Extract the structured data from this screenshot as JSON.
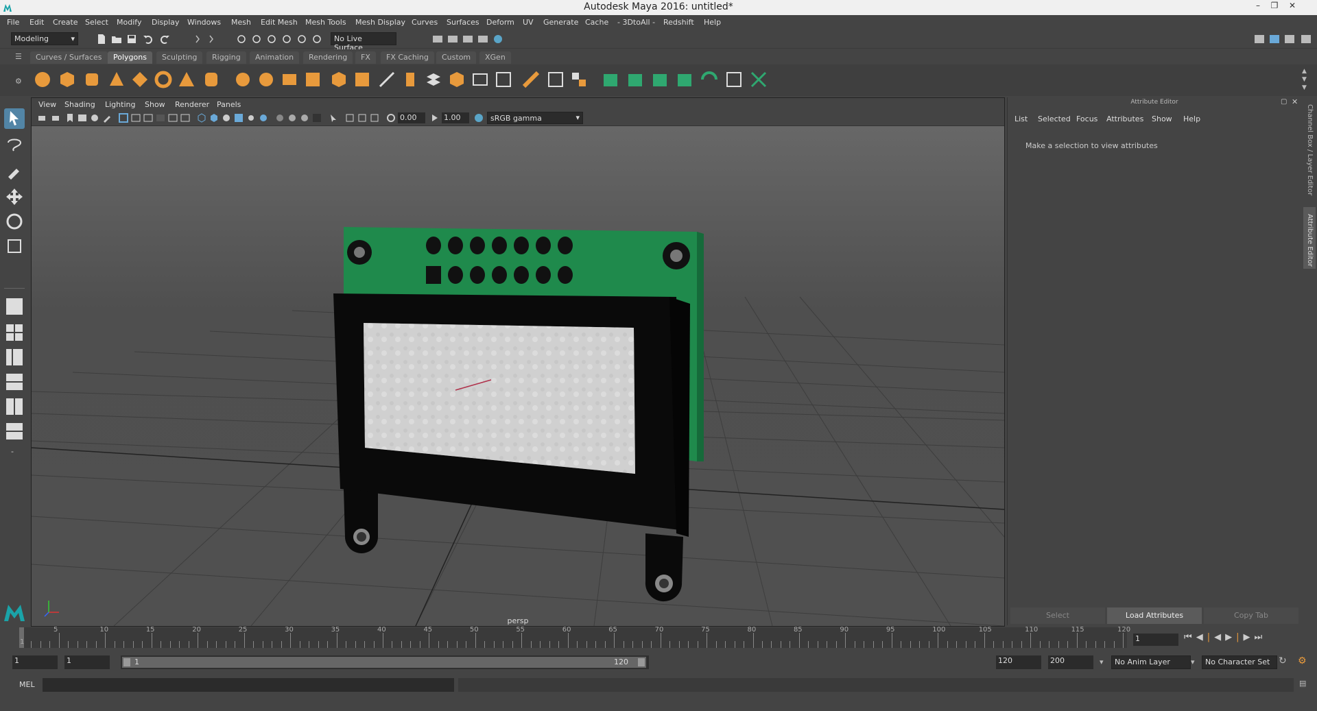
{
  "window": {
    "title": "Autodesk Maya 2016: untitled*"
  },
  "menubar": [
    "File",
    "Edit",
    "Create",
    "Select",
    "Modify",
    "Display",
    "Windows",
    "Mesh",
    "Edit Mesh",
    "Mesh Tools",
    "Mesh Display",
    "Curves",
    "Surfaces",
    "Deform",
    "UV",
    "Generate",
    "Cache",
    "- 3DtoAll -",
    "Redshift",
    "Help"
  ],
  "statusline": {
    "mode": "Modeling",
    "live_surface": "No Live Surface"
  },
  "shelf_tabs": [
    "Curves / Surfaces",
    "Polygons",
    "Sculpting",
    "Rigging",
    "Animation",
    "Rendering",
    "FX",
    "FX Caching",
    "Custom",
    "XGen"
  ],
  "shelf_active_tab": "Polygons",
  "viewport": {
    "menus": [
      "View",
      "Shading",
      "Lighting",
      "Show",
      "Renderer",
      "Panels"
    ],
    "exposure": "0.00",
    "gamma": "1.00",
    "color_space": "sRGB gamma",
    "camera_label": "persp"
  },
  "attribute_editor": {
    "title": "Attribute Editor",
    "menus": [
      "List",
      "Selected",
      "Focus",
      "Attributes",
      "Show",
      "Help"
    ],
    "message": "Make a selection to view attributes",
    "buttons": {
      "select": "Select",
      "load": "Load Attributes",
      "copy": "Copy Tab"
    }
  },
  "side_tabs": {
    "channel_box": "Channel Box / Layer Editor",
    "attr_editor": "Attribute Editor"
  },
  "timeline": {
    "ticks": [
      "5",
      "10",
      "15",
      "20",
      "25",
      "30",
      "35",
      "40",
      "45",
      "50",
      "55",
      "60",
      "65",
      "70",
      "75",
      "80",
      "85",
      "90",
      "95",
      "100",
      "105",
      "110",
      "115",
      "120"
    ],
    "first_tick": "1",
    "current_frame": "1"
  },
  "range": {
    "start": "1",
    "playback_start": "1",
    "slider_start": "1",
    "slider_end": "120",
    "playback_end": "120",
    "end": "200",
    "anim_layer": "No Anim Layer",
    "character_set": "No Character Set"
  },
  "commandline": {
    "label": "MEL"
  },
  "colors": {
    "accent": "#5285a6",
    "pcb_green": "#1f8a4c",
    "bg": "#444444"
  }
}
